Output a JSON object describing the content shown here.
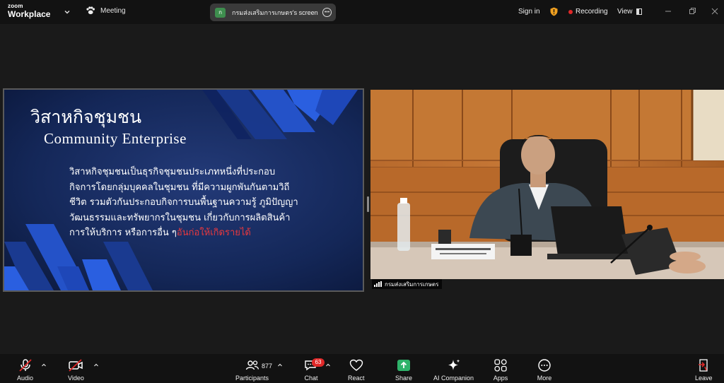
{
  "app": {
    "brand_small": "zoom",
    "brand_name": "Workplace",
    "meeting_label": "Meeting",
    "accent_green": "#3e8e4e",
    "recording_red": "#e02828"
  },
  "topbar": {
    "screen_share_badge": "ก",
    "screen_share_label": "กรมส่งเสริมการเกษตร's screen",
    "sign_in": "Sign in",
    "recording": "Recording",
    "view": "View"
  },
  "slide": {
    "title": "วิสาหกิจชุมชน",
    "subtitle": "Community  Enterprise",
    "body_lines": [
      "วิสาหกิจชุมชนเป็นธุรกิจชุมชนประเภทหนึ่งที่ประกอบ",
      "กิจการโดยกลุ่มบุคคลในชุมชน  ที่มีความผูกพันกันตามวิถี",
      "ชีวิต  รวมตัวกันประกอบกิจการบนพื้นฐานความรู้  ภูมิปัญญา",
      "วัฒนธรรมและทรัพยากรในชุมชน    เกี่ยวกับการผลิตสินค้า"
    ],
    "body_last_normal": "การให้บริการ  หรือการอื่น ๆ",
    "body_last_highlight": "อันก่อให้เกิดรายได้"
  },
  "camera": {
    "participant_name": "กรมส่งเสริมการเกษตร"
  },
  "toolbar": {
    "audio": "Audio",
    "video": "Video",
    "participants": "Participants",
    "participants_count": "877",
    "chat": "Chat",
    "chat_badge": "63",
    "react": "React",
    "share": "Share",
    "ai_companion": "AI Companion",
    "apps": "Apps",
    "more": "More",
    "leave": "Leave"
  }
}
